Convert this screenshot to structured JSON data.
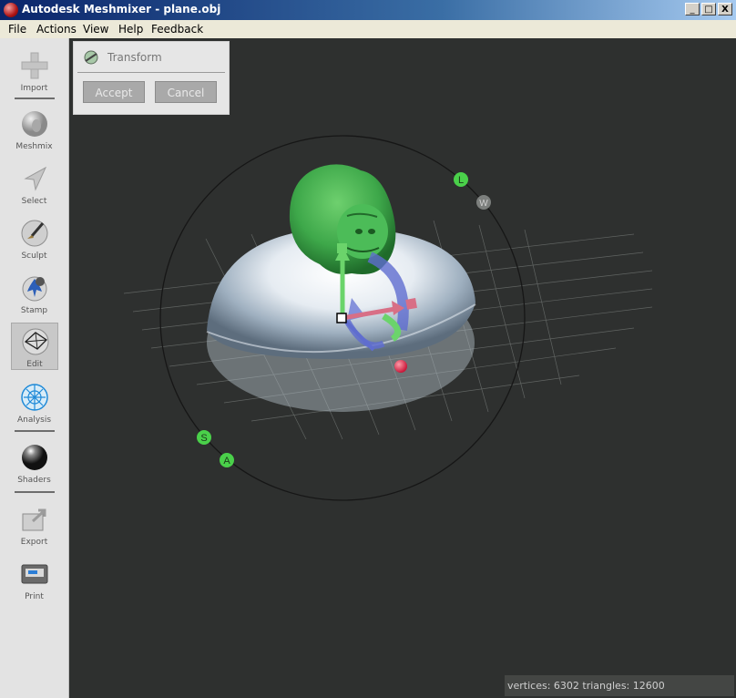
{
  "window": {
    "title": "Autodesk Meshmixer - plane.obj",
    "controls": {
      "minimize": "_",
      "maximize": "□",
      "close": "X"
    }
  },
  "menu": [
    "File",
    "Actions",
    "View",
    "Help",
    "Feedback"
  ],
  "sidebar": {
    "tools": [
      {
        "label": "Import",
        "icon": "plus-icon"
      },
      {
        "label": "Meshmix",
        "icon": "meshmix-icon"
      },
      {
        "label": "Select",
        "icon": "select-arrow-icon"
      },
      {
        "label": "Sculpt",
        "icon": "brush-icon"
      },
      {
        "label": "Stamp",
        "icon": "stamp-icon"
      },
      {
        "label": "Edit",
        "icon": "edit-icon",
        "active": true
      },
      {
        "label": "Analysis",
        "icon": "analysis-icon"
      },
      {
        "label": "Shaders",
        "icon": "shader-sphere-icon"
      },
      {
        "label": "Export",
        "icon": "export-icon"
      },
      {
        "label": "Print",
        "icon": "printer-icon"
      }
    ]
  },
  "transform_panel": {
    "title": "Transform",
    "accept_label": "Accept",
    "cancel_label": "Cancel"
  },
  "gizmo": {
    "labels": {
      "L": "L",
      "W": "W",
      "S": "S",
      "A": "A"
    }
  },
  "status_bar": {
    "text": "vertices: 6302 triangles: 12600"
  }
}
